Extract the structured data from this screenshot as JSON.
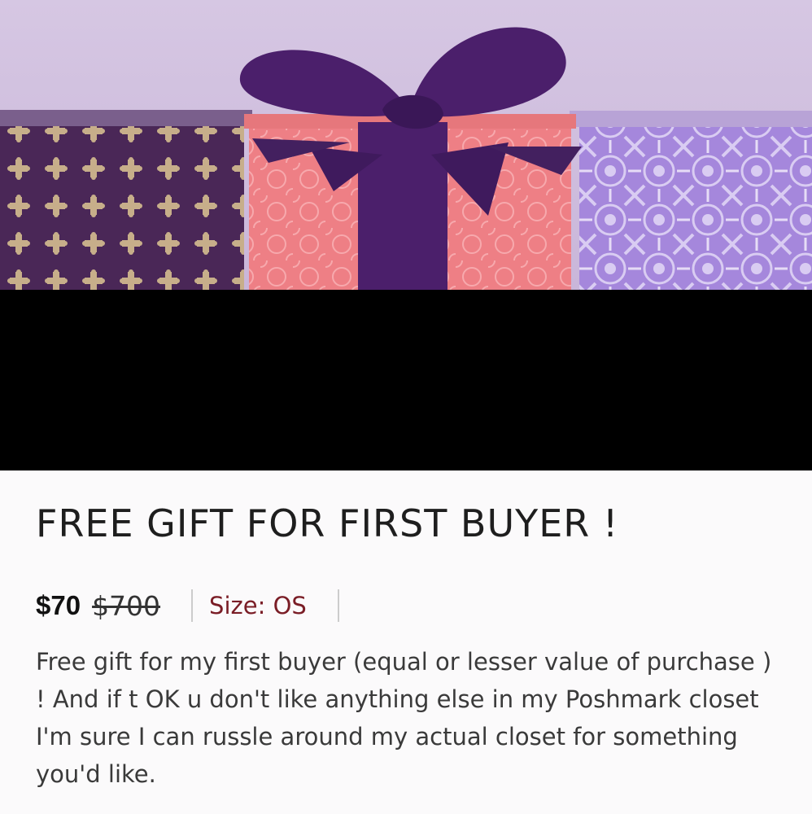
{
  "listing": {
    "image_alt": "gift-boxes-photo",
    "title": "FREE GIFT FOR FIRST BUYER !",
    "price": "$70",
    "original_price": "$700",
    "size_label": "Size: OS",
    "description": "Free gift for my first buyer (equal or lesser value of purchase ) ! And if t OK u don't like anything else in my Poshmark closet I'm sure I can russle around my actual closet for something you'd like."
  },
  "colors": {
    "size_text": "#7a1d26",
    "ribbon": "#4b1f6b",
    "box_left": "#4a2757",
    "box_center": "#ef7f86",
    "box_right": "#a487dc"
  }
}
